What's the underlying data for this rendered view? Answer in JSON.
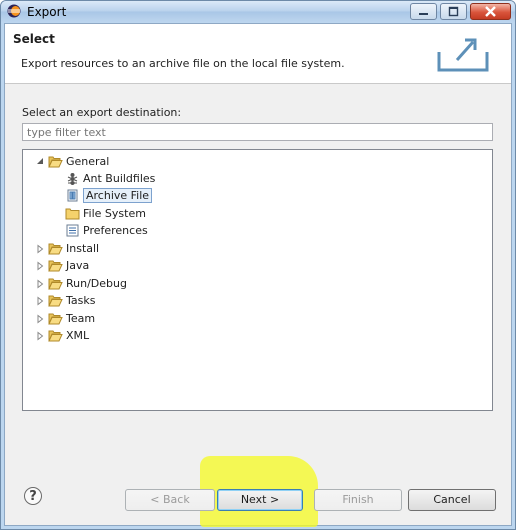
{
  "window": {
    "title": "Export"
  },
  "header": {
    "title": "Select",
    "description": "Export resources to an archive file on the local file system."
  },
  "destination": {
    "label": "Select an export destination:",
    "filter_placeholder": "type filter text"
  },
  "tree": {
    "general": {
      "label": "General",
      "children": [
        "Ant Buildfiles",
        "Archive File",
        "File System",
        "Preferences"
      ]
    },
    "others": [
      "Install",
      "Java",
      "Run/Debug",
      "Tasks",
      "Team",
      "XML"
    ]
  },
  "buttons": {
    "help": "?",
    "back": "< Back",
    "next": "Next >",
    "finish": "Finish",
    "cancel": "Cancel"
  }
}
